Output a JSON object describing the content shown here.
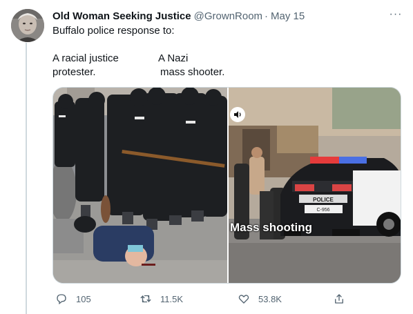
{
  "tweet": {
    "author_name": "Old Woman Seeking Justice",
    "handle": "@GrownRoom",
    "separator": "·",
    "date": "May 15",
    "more_label": "···",
    "line1": "Buffalo police response to:",
    "col1_line1": "A racial justice",
    "col1_line2": "protester.",
    "col2_line1": "A Nazi",
    "col2_line2": "mass shooter."
  },
  "media": {
    "right_caption": "Mass shooting",
    "car_label": "POLICE",
    "car_number": "C-956",
    "left_icon": "photo-police-line",
    "right_icon": "photo-police-car"
  },
  "actions": {
    "reply_count": "105",
    "retweet_count": "11.5K",
    "like_count": "53.8K",
    "reply_icon": "reply-icon",
    "retweet_icon": "retweet-icon",
    "like_icon": "heart-icon",
    "share_icon": "share-icon"
  },
  "colors": {
    "text": "#0f1419",
    "secondary": "#536471",
    "border": "#cfd9de"
  }
}
